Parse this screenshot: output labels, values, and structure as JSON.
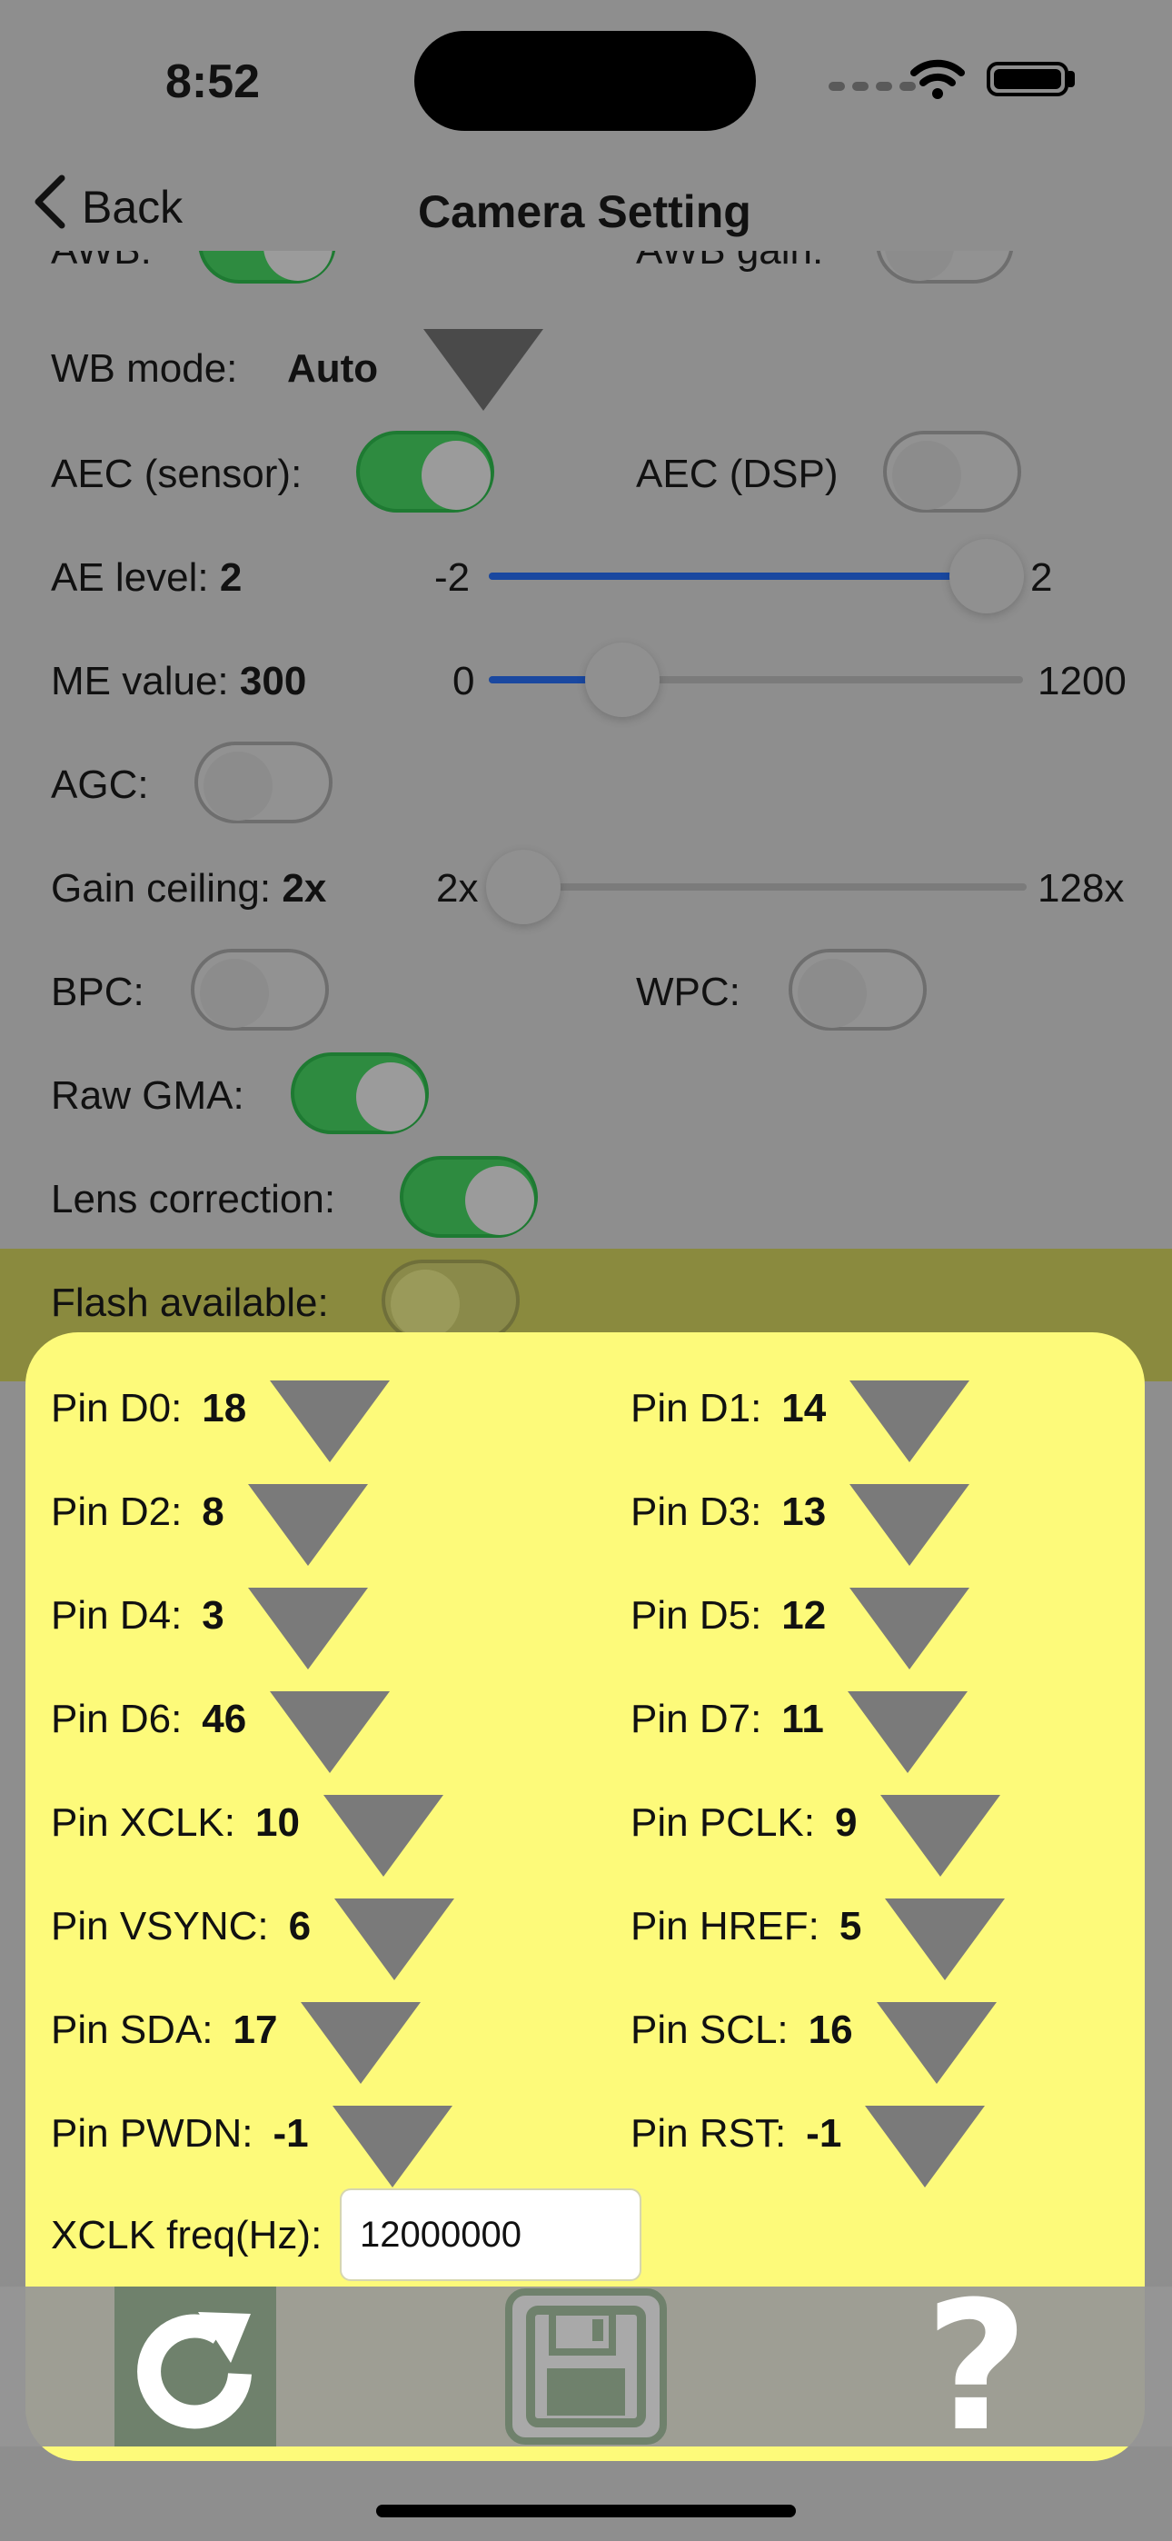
{
  "status_bar": {
    "time": "8:52"
  },
  "nav": {
    "back_label": "Back",
    "title": "Camera Setting"
  },
  "settings": {
    "awb_label": "AWB:",
    "awb_gain_label": "AWB gain:",
    "wb_mode_label": "WB mode:",
    "wb_mode_value": "Auto",
    "aec_sensor_label": "AEC (sensor):",
    "aec_dsp_label": "AEC (DSP)",
    "ae_level_label": "AE level:",
    "ae_level_value": "2",
    "ae_level_min": "-2",
    "ae_level_max": "2",
    "me_value_label": "ME value:",
    "me_value_value": "300",
    "me_value_min": "0",
    "me_value_max": "1200",
    "agc_label": "AGC:",
    "gain_ceiling_label": "Gain ceiling:",
    "gain_ceiling_value": "2x",
    "gain_ceiling_min": "2x",
    "gain_ceiling_max": "128x",
    "bpc_label": "BPC:",
    "wpc_label": "WPC:",
    "raw_gma_label": "Raw GMA:",
    "lens_correction_label": "Lens correction:",
    "flash_available_label": "Flash available:"
  },
  "switch_states": {
    "awb": true,
    "awb_gain": false,
    "aec_sensor": true,
    "aec_dsp": false,
    "agc": false,
    "bpc": false,
    "wpc": false,
    "raw_gma": true,
    "lens_correction": true,
    "flash_available": false
  },
  "slider_levels": {
    "ae_level": 1.0,
    "me_value": 0.25,
    "gain_ceiling": 0.0
  },
  "pins": [
    {
      "label": "Pin D0:",
      "value": "18"
    },
    {
      "label": "Pin D1:",
      "value": "14"
    },
    {
      "label": "Pin D2:",
      "value": "8"
    },
    {
      "label": "Pin D3:",
      "value": "13"
    },
    {
      "label": "Pin D4:",
      "value": "3"
    },
    {
      "label": "Pin D5:",
      "value": "12"
    },
    {
      "label": "Pin D6:",
      "value": "46"
    },
    {
      "label": "Pin D7:",
      "value": "11"
    },
    {
      "label": "Pin XCLK:",
      "value": "10"
    },
    {
      "label": "Pin PCLK:",
      "value": "9"
    },
    {
      "label": "Pin VSYNC:",
      "value": "6"
    },
    {
      "label": "Pin HREF:",
      "value": "5"
    },
    {
      "label": "Pin SDA:",
      "value": "17"
    },
    {
      "label": "Pin SCL:",
      "value": "16"
    },
    {
      "label": "Pin PWDN:",
      "value": "-1"
    },
    {
      "label": "Pin RST:",
      "value": "-1"
    }
  ],
  "xclk": {
    "label": "XCLK freq(Hz):",
    "value": "12000000"
  },
  "toolbar": {
    "help_glyph": "?"
  },
  "icons": {
    "back": "chevron-left-icon",
    "wifi": "wifi-icon",
    "cellular": "cellular-icon",
    "battery": "battery-icon",
    "reload": "reload-icon",
    "save": "floppy-disk-icon",
    "help": "help-icon"
  },
  "colors": {
    "switch_on": "#2e8b40",
    "slider_fill": "#1a48a0",
    "panel": "#fdfa7a",
    "toolbar_button": "#6f816c"
  }
}
